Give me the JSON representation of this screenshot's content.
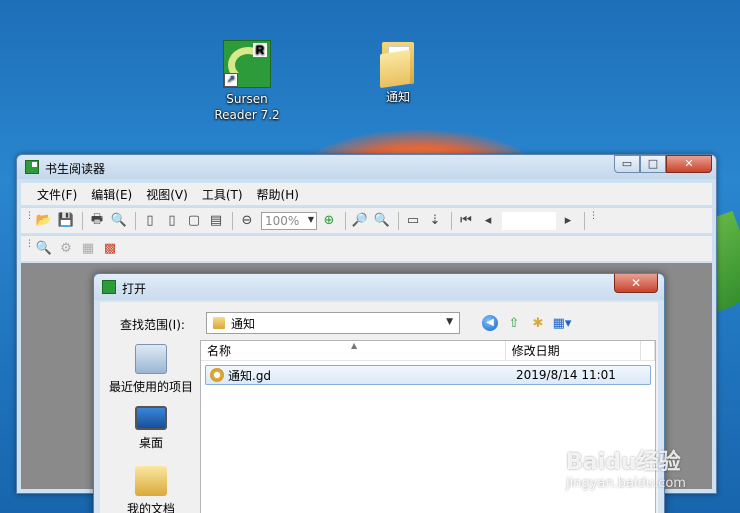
{
  "desktop": {
    "icons": [
      {
        "label": "Sursen\nReader 7.2",
        "icon": "sursen-reader-shortcut-icon"
      },
      {
        "label": "通知",
        "icon": "folder-icon"
      }
    ]
  },
  "app": {
    "title": "书生阅读器",
    "menu": [
      "文件(F)",
      "编辑(E)",
      "视图(V)",
      "工具(T)",
      "帮助(H)"
    ],
    "zoom_value": "100%",
    "window_buttons": {
      "minimize": "▭",
      "maximize": "□",
      "close": "✕"
    }
  },
  "dialog": {
    "title": "打开",
    "close_label": "✕",
    "look_in_label": "查找范围(I):",
    "look_in_value": "通知",
    "places": [
      "最近使用的项目",
      "桌面",
      "我的文档"
    ],
    "columns": {
      "name": "名称",
      "date": "修改日期"
    },
    "files": [
      {
        "name": "通知.gd",
        "date": "2019/8/14 11:01"
      }
    ]
  },
  "watermark": {
    "main": "Baidu经验",
    "sub": "jingyan.baidu.com"
  },
  "colors": {
    "desktop": "#2a86cf",
    "selection": "#dce9f8",
    "close_button": "#c8432b"
  }
}
